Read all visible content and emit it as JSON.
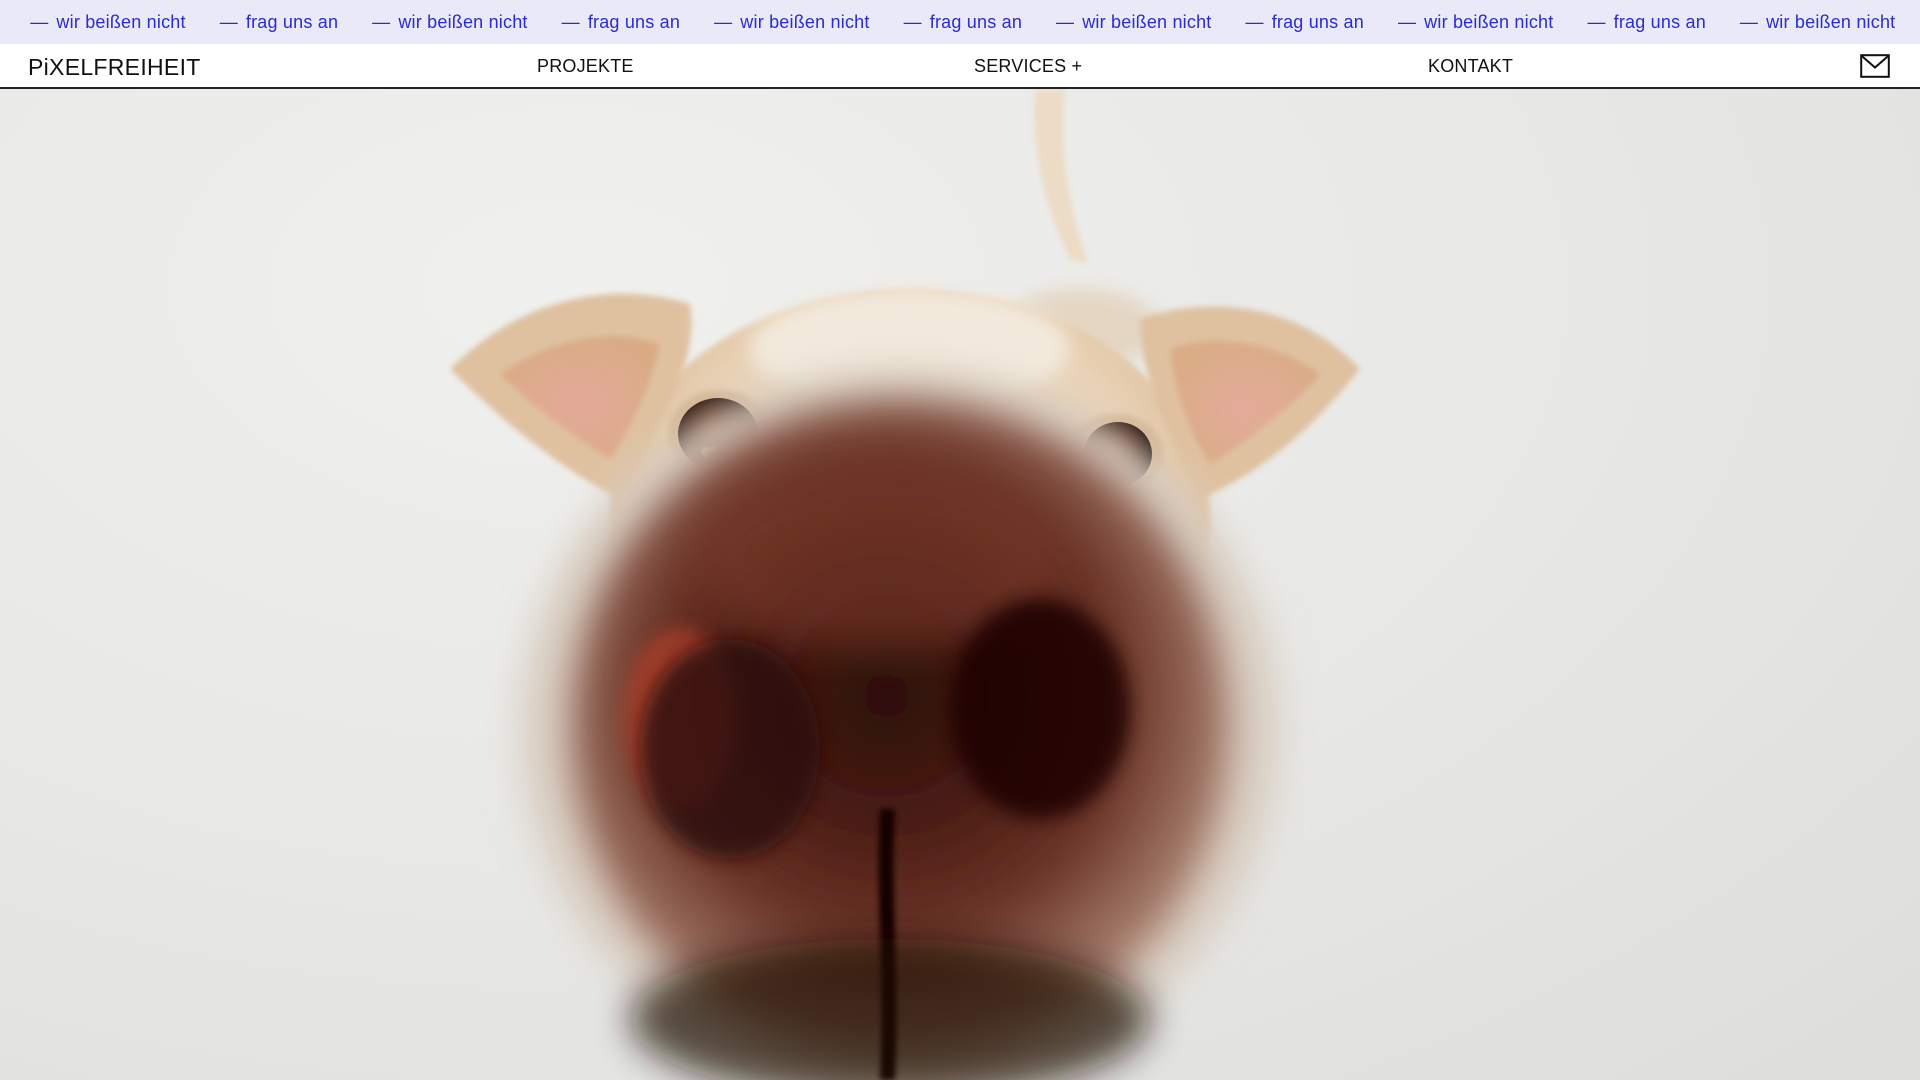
{
  "marquee": {
    "fragment_start": "n",
    "phrase_a": "wir beißen nicht",
    "phrase_b": "frag uns an",
    "dash": "—",
    "repeats": 7,
    "color": "#2b2bd0",
    "background": "#e9e9f8"
  },
  "nav": {
    "logo": "PiXELFREIHEIT",
    "links": [
      {
        "label": "PROJEKTE"
      },
      {
        "label": "SERVICES +"
      },
      {
        "label": "KONTAKT"
      }
    ],
    "mail_icon": "envelope-icon"
  },
  "hero": {
    "image": "dog-closeup-nose-photo"
  }
}
